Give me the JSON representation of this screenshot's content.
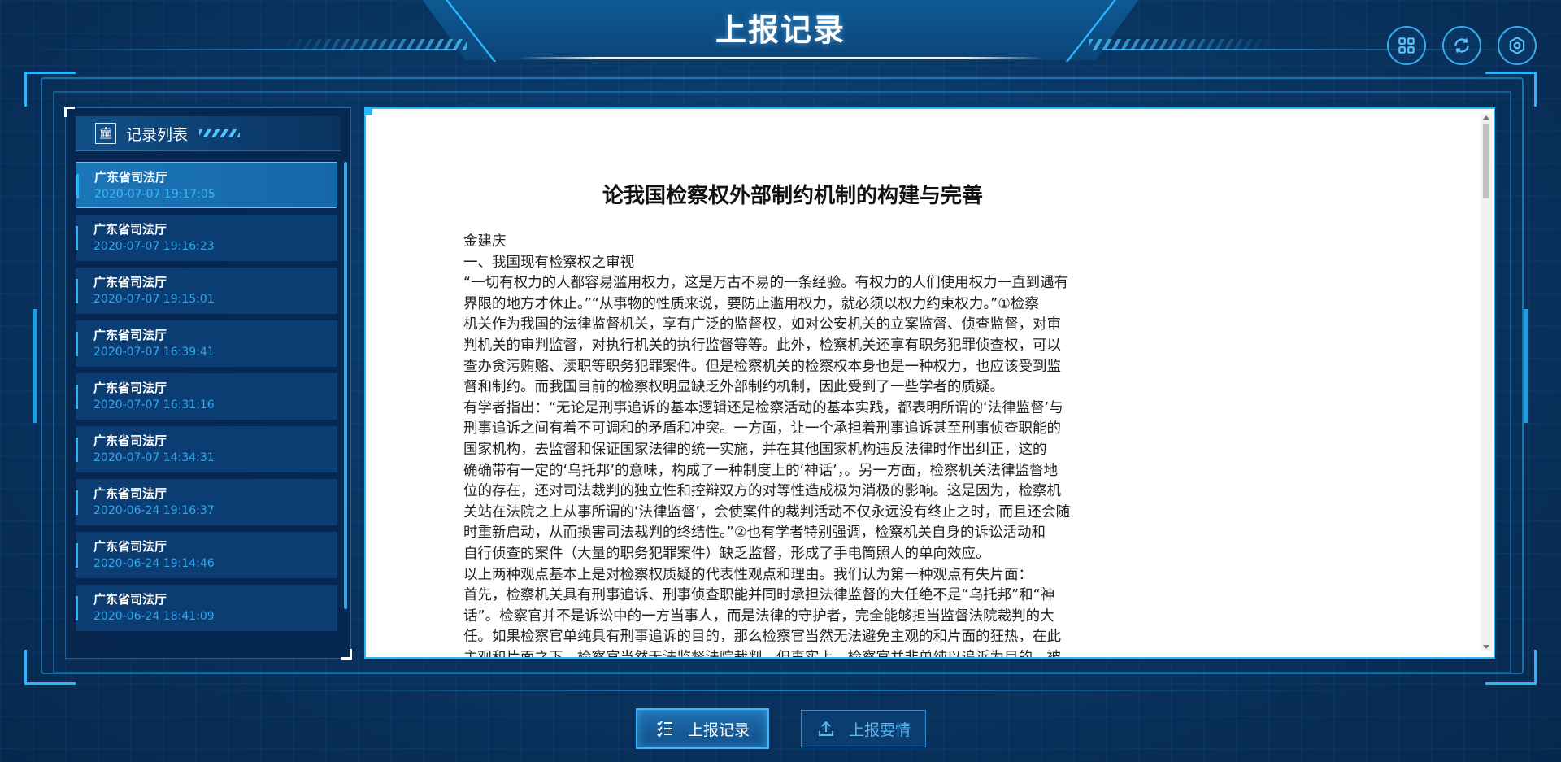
{
  "header": {
    "title": "上报记录",
    "icons": [
      "grid-icon",
      "refresh-icon",
      "settings-icon"
    ]
  },
  "sidebar": {
    "title": "记录列表",
    "items": [
      {
        "name": "广东省司法厅",
        "time": "2020-07-07 19:17:05",
        "active": true
      },
      {
        "name": "广东省司法厅",
        "time": "2020-07-07 19:16:23"
      },
      {
        "name": "广东省司法厅",
        "time": "2020-07-07 19:15:01"
      },
      {
        "name": "广东省司法厅",
        "time": "2020-07-07 16:39:41"
      },
      {
        "name": "广东省司法厅",
        "time": "2020-07-07 16:31:16"
      },
      {
        "name": "广东省司法厅",
        "time": "2020-07-07 14:34:31"
      },
      {
        "name": "广东省司法厅",
        "time": "2020-06-24 19:16:37"
      },
      {
        "name": "广东省司法厅",
        "time": "2020-06-24 19:14:46"
      },
      {
        "name": "广东省司法厅",
        "time": "2020-06-24 18:41:09"
      }
    ]
  },
  "document": {
    "title": "论我国检察权外部制约机制的构建与完善",
    "lines": [
      "金建庆",
      "一、我国现有检察权之审视",
      "“一切有权力的人都容易滥用权力，这是万古不易的一条经验。有权力的人们使用权力一直到遇有",
      "界限的地方才休止。”“从事物的性质来说，要防止滥用权力，就必须以权力约束权力。”①检察",
      "机关作为我国的法律监督机关，享有广泛的监督权，如对公安机关的立案监督、侦查监督，对审",
      "判机关的审判监督，对执行机关的执行监督等等。此外，检察机关还享有职务犯罪侦查权，可以",
      "查办贪污贿赂、渎职等职务犯罪案件。但是检察机关的检察权本身也是一种权力，也应该受到监",
      "督和制约。而我国目前的检察权明显缺乏外部制约机制，因此受到了一些学者的质疑。",
      "有学者指出：“无论是刑事追诉的基本逻辑还是检察活动的基本实践，都表明所谓的‘法律监督’与",
      "刑事追诉之间有着不可调和的矛盾和冲突。一方面，让一个承担着刑事追诉甚至刑事侦查职能的",
      "国家机构，去监督和保证国家法律的统一实施，并在其他国家机构违反法律时作出纠正，这的",
      "确确带有一定的‘乌托邦’的意味，构成了一种制度上的‘神话’，。另一方面，检察机关法律监督地",
      "位的存在，还对司法裁判的独立性和控辩双方的对等性造成极为消极的影响。这是因为，检察机",
      "关站在法院之上从事所谓的‘法律监督’，会使案件的裁判活动不仅永远没有终止之时，而且还会随",
      "时重新启动，从而损害司法裁判的终结性。”②也有学者特别强调，检察机关自身的诉讼活动和",
      "自行侦查的案件（大量的职务犯罪案件）缺乏监督，形成了手电筒照人的单向效应。",
      "以上两种观点基本上是对检察权质疑的代表性观点和理由。我们认为第一种观点有失片面：",
      "首先，检察机关具有刑事追诉、刑事侦查职能并同时承担法律监督的大任绝不是“乌托邦”和“神",
      "话”。检察官并不是诉讼中的一方当事人，而是法律的守护者，完全能够担当监督法院裁判的大",
      "任。如果检察官单纯具有刑事追诉的目的，那么检察官当然无法避免主观的和片面的狂热，在此",
      "主观和片面之下，检察官当然无法监督法院裁判。但事实上，检察官并非单纯以追诉为目的，被"
    ]
  },
  "tabs": {
    "records": "上报记录",
    "report": "上报要情"
  },
  "colors": {
    "accent": "#2ab6ff",
    "background": "#0a3765",
    "time_text": "#2fa9ef"
  }
}
